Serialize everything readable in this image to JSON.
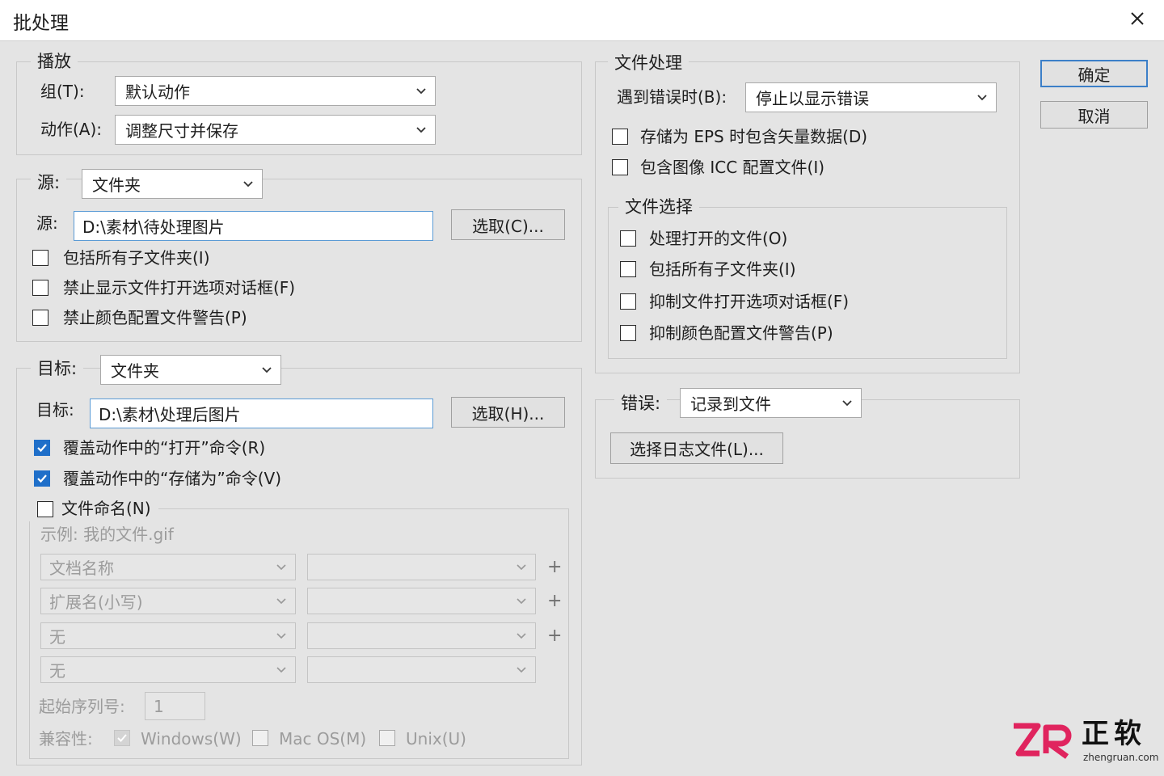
{
  "window": {
    "title": "批处理"
  },
  "play": {
    "legend": "播放",
    "group_label": "组(T):",
    "group_value": "默认动作",
    "action_label": "动作(A):",
    "action_value": "调整尺寸并保存"
  },
  "source": {
    "legend": "源:",
    "type_value": "文件夹",
    "path_label": "源:",
    "path_value": "D:\\素材\\待处理图片",
    "choose_button": "选取(C)...",
    "options": [
      {
        "label": "包括所有子文件夹(I)",
        "checked": false
      },
      {
        "label": "禁止显示文件打开选项对话框(F)",
        "checked": false
      },
      {
        "label": "禁止颜色配置文件警告(P)",
        "checked": false
      }
    ]
  },
  "target": {
    "legend": "目标:",
    "type_value": "文件夹",
    "path_label": "目标:",
    "path_value": "D:\\素材\\处理后图片",
    "choose_button": "选取(H)...",
    "options": [
      {
        "label": "覆盖动作中的“打开”命令(R)",
        "checked": true
      },
      {
        "label": "覆盖动作中的“存储为”命令(V)",
        "checked": true
      }
    ],
    "naming": {
      "label": "文件命名(N)",
      "checked": false,
      "example": "示例:  我的文件.gif",
      "rows": [
        {
          "left": "文档名称",
          "right": "",
          "plus": "+"
        },
        {
          "left": "扩展名(小写)",
          "right": "",
          "plus": "+"
        },
        {
          "left": "无",
          "right": "",
          "plus": "+"
        },
        {
          "left": "无",
          "right": "",
          "plus": ""
        }
      ],
      "serial_label": "起始序列号:",
      "serial_value": "1",
      "compat_label": "兼容性:",
      "compat": [
        {
          "label": "Windows(W)",
          "checked": true
        },
        {
          "label": "Mac OS(M)",
          "checked": false
        },
        {
          "label": "Unix(U)",
          "checked": false
        }
      ]
    }
  },
  "file_processing": {
    "legend": "文件处理",
    "error_label": "遇到错误时(B):",
    "error_value": "停止以显示错误",
    "options": [
      {
        "label": "存储为 EPS 时包含矢量数据(D)",
        "checked": false
      },
      {
        "label": "包含图像 ICC 配置文件(I)",
        "checked": false
      }
    ],
    "selection": {
      "legend": "文件选择",
      "options": [
        {
          "label": "处理打开的文件(O)",
          "checked": false
        },
        {
          "label": "包括所有子文件夹(I)",
          "checked": false
        },
        {
          "label": "抑制文件打开选项对话框(F)",
          "checked": false
        },
        {
          "label": "抑制颜色配置文件警告(P)",
          "checked": false
        }
      ]
    }
  },
  "errors": {
    "legend": "错误:",
    "value": "记录到文件",
    "log_button": "选择日志文件(L)..."
  },
  "buttons": {
    "ok": "确定",
    "cancel": "取消"
  },
  "watermark": {
    "brand": "正软",
    "domain": "zhengruan.com",
    "logo_text": "ZR",
    "color": "#e0245e"
  },
  "icons": {
    "close": "close-icon",
    "dropdown": "chevron-down-icon",
    "check": "checkmark-icon"
  }
}
